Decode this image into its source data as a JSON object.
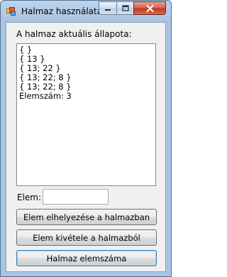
{
  "window": {
    "title": "Halmaz használata"
  },
  "main": {
    "state_label": "A halmaz aktuális állapota:",
    "list_lines": [
      "{  }",
      "{ 13 }",
      "{ 13; 22 }",
      "{ 13; 22; 8 }",
      "{ 13; 22; 8 }",
      "Elemszám: 3"
    ],
    "element_label": "Elem:",
    "element_value": ""
  },
  "buttons": {
    "locate": "Elem elhelyezése a halmazban",
    "remove": "Elem kivétele a halmazból",
    "count": "Halmaz elemszáma"
  },
  "icons": {
    "app": "app-window-icon",
    "minimize": "minimize-icon",
    "maximize": "maximize-icon",
    "close": "close-icon"
  },
  "colors": {
    "close_button": "#c2381f",
    "focus_button_border": "#3c7fb1"
  }
}
